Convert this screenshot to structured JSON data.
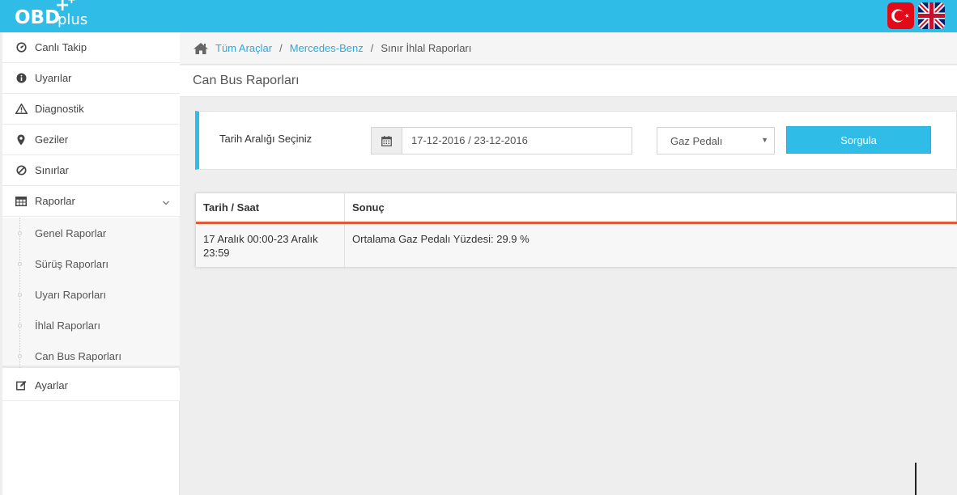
{
  "app": {
    "logo_main": "OBD",
    "logo_suffix": "plus",
    "logo_cross": "+",
    "logo_cross_small": "+"
  },
  "languages": [
    {
      "code": "tr",
      "icon": "turkish-flag-icon"
    },
    {
      "code": "en",
      "icon": "uk-flag-icon"
    }
  ],
  "sidebar": {
    "items": [
      {
        "label": "Canlı Takip",
        "icon": "dashboard-icon"
      },
      {
        "label": "Uyarılar",
        "icon": "info-circle-icon"
      },
      {
        "label": "Diagnostik",
        "icon": "warning-triangle-icon"
      },
      {
        "label": "Geziler",
        "icon": "map-marker-icon"
      },
      {
        "label": "Sınırlar",
        "icon": "ban-icon"
      },
      {
        "label": "Raporlar",
        "icon": "table-icon"
      },
      {
        "label": "Ayarlar",
        "icon": "edit-icon"
      }
    ],
    "submenu": [
      {
        "label": "Genel Raporlar"
      },
      {
        "label": "Sürüş Raporları"
      },
      {
        "label": "Uyarı Raporları"
      },
      {
        "label": "İhlal Raporları"
      },
      {
        "label": "Can Bus Raporları"
      }
    ]
  },
  "breadcrumb": {
    "items": [
      "Tüm Araçlar",
      "Mercedes-Benz"
    ],
    "current": "Sınır İhlal Raporları",
    "separator": "/"
  },
  "page": {
    "title": "Can Bus Raporları"
  },
  "filter": {
    "label": "Tarih Aralığı Seçiniz",
    "date_range": "17-12-2016 / 23-12-2016",
    "select_value": "Gaz Pedalı",
    "select_arrow": "▼",
    "button_label": "Sorgula"
  },
  "table": {
    "headers": [
      "Tarih / Saat",
      "Sonuç"
    ],
    "rows": [
      [
        "17 Aralık 00:00-23 Aralık 23:59",
        "Ortalama Gaz Pedalı Yüzdesi: 29.9 %"
      ]
    ]
  },
  "colors": {
    "accent": "#2fbde8",
    "link": "#2fa7d8",
    "table_header_line": "#e25a34"
  }
}
